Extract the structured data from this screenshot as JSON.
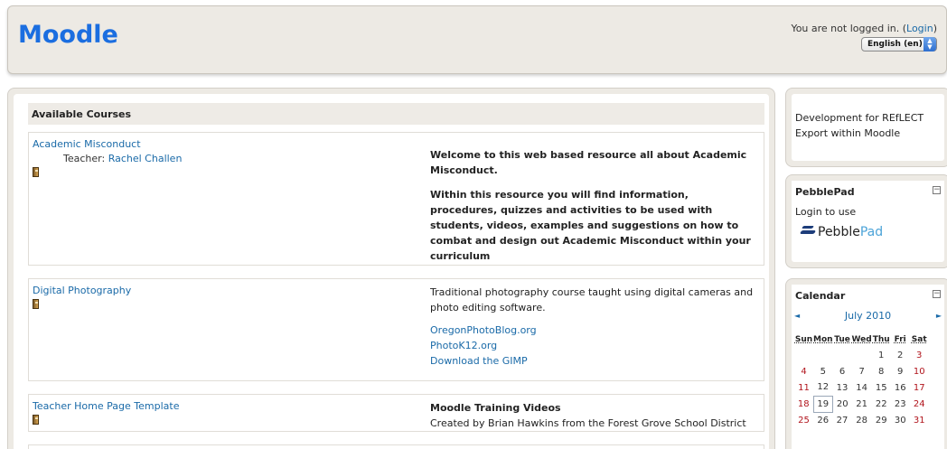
{
  "header": {
    "site_name": "Moodle",
    "login_text": "You are not logged in. (",
    "login_link": "Login",
    "login_close": ")",
    "language": "English (en)"
  },
  "courses": {
    "heading": "Available Courses",
    "items": [
      {
        "title": "Academic Misconduct",
        "teacher_label": "Teacher:",
        "teacher_name": "Rachel Challen",
        "summary1": "Welcome to this web based resource all about Academic Misconduct.",
        "summary2": "Within this resource you will find information, procedures, quizzes and activities to be used with students, videos, examples and suggestions on how to combat and design out Academic Misconduct within your curriculum"
      },
      {
        "title": "Digital Photography",
        "summary1": "Traditional photography course taught using digital cameras and photo editing software.",
        "links": [
          "OregonPhotoBlog.org",
          "PhotoK12.org",
          "Download the GIMP"
        ]
      },
      {
        "title": "Teacher Home Page Template",
        "summary_title": "Moodle Training Videos",
        "summary1": "Created by Brian Hawkins from the Forest Grove School District"
      }
    ]
  },
  "sidebar": {
    "reflect_text": "Development for REfLECT Export within Moodle",
    "pebblepad": {
      "title": "PebblePad",
      "login_text": "Login to use",
      "logo_main": "Pebble",
      "logo_accent": "Pad"
    },
    "calendar": {
      "title": "Calendar",
      "month": "July 2010",
      "prev": "◄",
      "next": "►",
      "days": [
        "Sun",
        "Mon",
        "Tue",
        "Wed",
        "Thu",
        "Fri",
        "Sat"
      ],
      "weeks": [
        [
          "",
          "",
          "",
          "",
          "1",
          "2",
          "3"
        ],
        [
          "4",
          "5",
          "6",
          "7",
          "8",
          "9",
          "10"
        ],
        [
          "11",
          "12",
          "13",
          "14",
          "15",
          "16",
          "17"
        ],
        [
          "18",
          "19",
          "20",
          "21",
          "22",
          "23",
          "24"
        ],
        [
          "25",
          "26",
          "27",
          "28",
          "29",
          "30",
          "31"
        ]
      ],
      "today": "19"
    }
  },
  "colors": {
    "logo": "#1b6ee0",
    "link": "#1a6aa8",
    "weekend": "#b1141c",
    "panel_bg": "#edeae4"
  }
}
